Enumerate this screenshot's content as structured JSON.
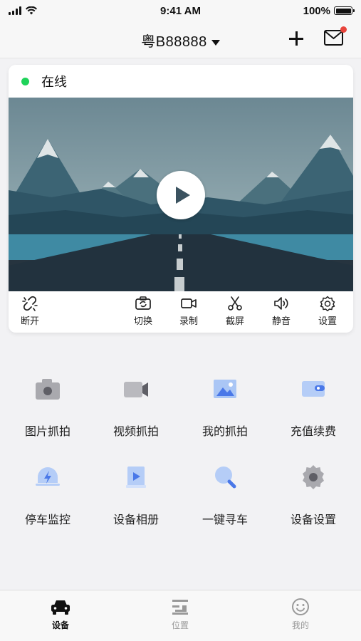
{
  "status_bar": {
    "time": "9:41 AM",
    "battery": "100%"
  },
  "header": {
    "plate": "粤B88888"
  },
  "camera": {
    "status": "在线",
    "controls": {
      "disconnect": "断开",
      "switch": "切换",
      "record": "录制",
      "screenshot": "截屏",
      "mute": "静音",
      "settings": "设置"
    }
  },
  "grid": [
    {
      "label": "图片抓拍",
      "icon": "photo-capture-icon"
    },
    {
      "label": "视频抓拍",
      "icon": "video-capture-icon"
    },
    {
      "label": "我的抓拍",
      "icon": "my-captures-icon"
    },
    {
      "label": "充值续费",
      "icon": "wallet-icon"
    },
    {
      "label": "停车监控",
      "icon": "parking-monitor-icon"
    },
    {
      "label": "设备相册",
      "icon": "device-album-icon"
    },
    {
      "label": "一键寻车",
      "icon": "find-car-icon"
    },
    {
      "label": "设备设置",
      "icon": "device-settings-icon"
    }
  ],
  "tabs": [
    {
      "label": "设备",
      "active": true
    },
    {
      "label": "位置",
      "active": false
    },
    {
      "label": "我的",
      "active": false
    }
  ],
  "colors": {
    "online": "#1fd35a",
    "badge": "#e8453c",
    "icon_blue": "#4a78e8"
  }
}
